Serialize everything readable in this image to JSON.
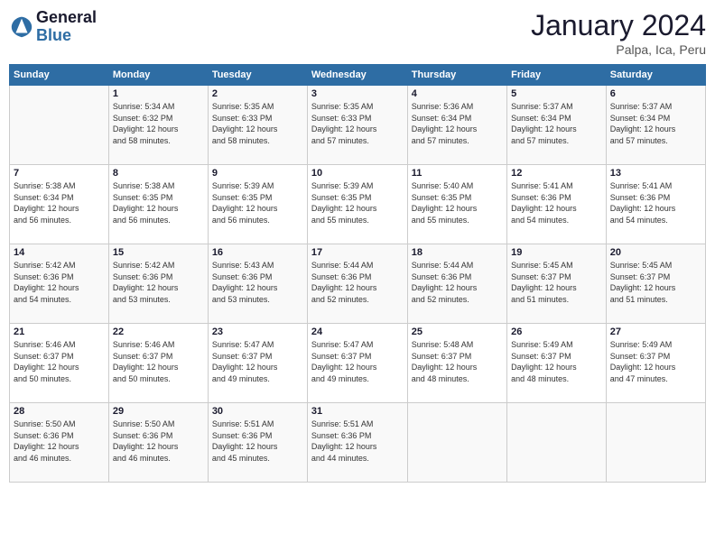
{
  "logo": {
    "line1": "General",
    "line2": "Blue"
  },
  "title": "January 2024",
  "subtitle": "Palpa, Ica, Peru",
  "weekdays": [
    "Sunday",
    "Monday",
    "Tuesday",
    "Wednesday",
    "Thursday",
    "Friday",
    "Saturday"
  ],
  "weeks": [
    [
      null,
      {
        "day": 1,
        "sunrise": "5:34 AM",
        "sunset": "6:32 PM",
        "daylight": "12 hours and 58 minutes."
      },
      {
        "day": 2,
        "sunrise": "5:35 AM",
        "sunset": "6:33 PM",
        "daylight": "12 hours and 58 minutes."
      },
      {
        "day": 3,
        "sunrise": "5:35 AM",
        "sunset": "6:33 PM",
        "daylight": "12 hours and 57 minutes."
      },
      {
        "day": 4,
        "sunrise": "5:36 AM",
        "sunset": "6:34 PM",
        "daylight": "12 hours and 57 minutes."
      },
      {
        "day": 5,
        "sunrise": "5:37 AM",
        "sunset": "6:34 PM",
        "daylight": "12 hours and 57 minutes."
      },
      {
        "day": 6,
        "sunrise": "5:37 AM",
        "sunset": "6:34 PM",
        "daylight": "12 hours and 57 minutes."
      }
    ],
    [
      {
        "day": 7,
        "sunrise": "5:38 AM",
        "sunset": "6:34 PM",
        "daylight": "12 hours and 56 minutes."
      },
      {
        "day": 8,
        "sunrise": "5:38 AM",
        "sunset": "6:35 PM",
        "daylight": "12 hours and 56 minutes."
      },
      {
        "day": 9,
        "sunrise": "5:39 AM",
        "sunset": "6:35 PM",
        "daylight": "12 hours and 56 minutes."
      },
      {
        "day": 10,
        "sunrise": "5:39 AM",
        "sunset": "6:35 PM",
        "daylight": "12 hours and 55 minutes."
      },
      {
        "day": 11,
        "sunrise": "5:40 AM",
        "sunset": "6:35 PM",
        "daylight": "12 hours and 55 minutes."
      },
      {
        "day": 12,
        "sunrise": "5:41 AM",
        "sunset": "6:36 PM",
        "daylight": "12 hours and 54 minutes."
      },
      {
        "day": 13,
        "sunrise": "5:41 AM",
        "sunset": "6:36 PM",
        "daylight": "12 hours and 54 minutes."
      }
    ],
    [
      {
        "day": 14,
        "sunrise": "5:42 AM",
        "sunset": "6:36 PM",
        "daylight": "12 hours and 54 minutes."
      },
      {
        "day": 15,
        "sunrise": "5:42 AM",
        "sunset": "6:36 PM",
        "daylight": "12 hours and 53 minutes."
      },
      {
        "day": 16,
        "sunrise": "5:43 AM",
        "sunset": "6:36 PM",
        "daylight": "12 hours and 53 minutes."
      },
      {
        "day": 17,
        "sunrise": "5:44 AM",
        "sunset": "6:36 PM",
        "daylight": "12 hours and 52 minutes."
      },
      {
        "day": 18,
        "sunrise": "5:44 AM",
        "sunset": "6:36 PM",
        "daylight": "12 hours and 52 minutes."
      },
      {
        "day": 19,
        "sunrise": "5:45 AM",
        "sunset": "6:37 PM",
        "daylight": "12 hours and 51 minutes."
      },
      {
        "day": 20,
        "sunrise": "5:45 AM",
        "sunset": "6:37 PM",
        "daylight": "12 hours and 51 minutes."
      }
    ],
    [
      {
        "day": 21,
        "sunrise": "5:46 AM",
        "sunset": "6:37 PM",
        "daylight": "12 hours and 50 minutes."
      },
      {
        "day": 22,
        "sunrise": "5:46 AM",
        "sunset": "6:37 PM",
        "daylight": "12 hours and 50 minutes."
      },
      {
        "day": 23,
        "sunrise": "5:47 AM",
        "sunset": "6:37 PM",
        "daylight": "12 hours and 49 minutes."
      },
      {
        "day": 24,
        "sunrise": "5:47 AM",
        "sunset": "6:37 PM",
        "daylight": "12 hours and 49 minutes."
      },
      {
        "day": 25,
        "sunrise": "5:48 AM",
        "sunset": "6:37 PM",
        "daylight": "12 hours and 48 minutes."
      },
      {
        "day": 26,
        "sunrise": "5:49 AM",
        "sunset": "6:37 PM",
        "daylight": "12 hours and 48 minutes."
      },
      {
        "day": 27,
        "sunrise": "5:49 AM",
        "sunset": "6:37 PM",
        "daylight": "12 hours and 47 minutes."
      }
    ],
    [
      {
        "day": 28,
        "sunrise": "5:50 AM",
        "sunset": "6:36 PM",
        "daylight": "12 hours and 46 minutes."
      },
      {
        "day": 29,
        "sunrise": "5:50 AM",
        "sunset": "6:36 PM",
        "daylight": "12 hours and 46 minutes."
      },
      {
        "day": 30,
        "sunrise": "5:51 AM",
        "sunset": "6:36 PM",
        "daylight": "12 hours and 45 minutes."
      },
      {
        "day": 31,
        "sunrise": "5:51 AM",
        "sunset": "6:36 PM",
        "daylight": "12 hours and 44 minutes."
      },
      null,
      null,
      null
    ]
  ]
}
